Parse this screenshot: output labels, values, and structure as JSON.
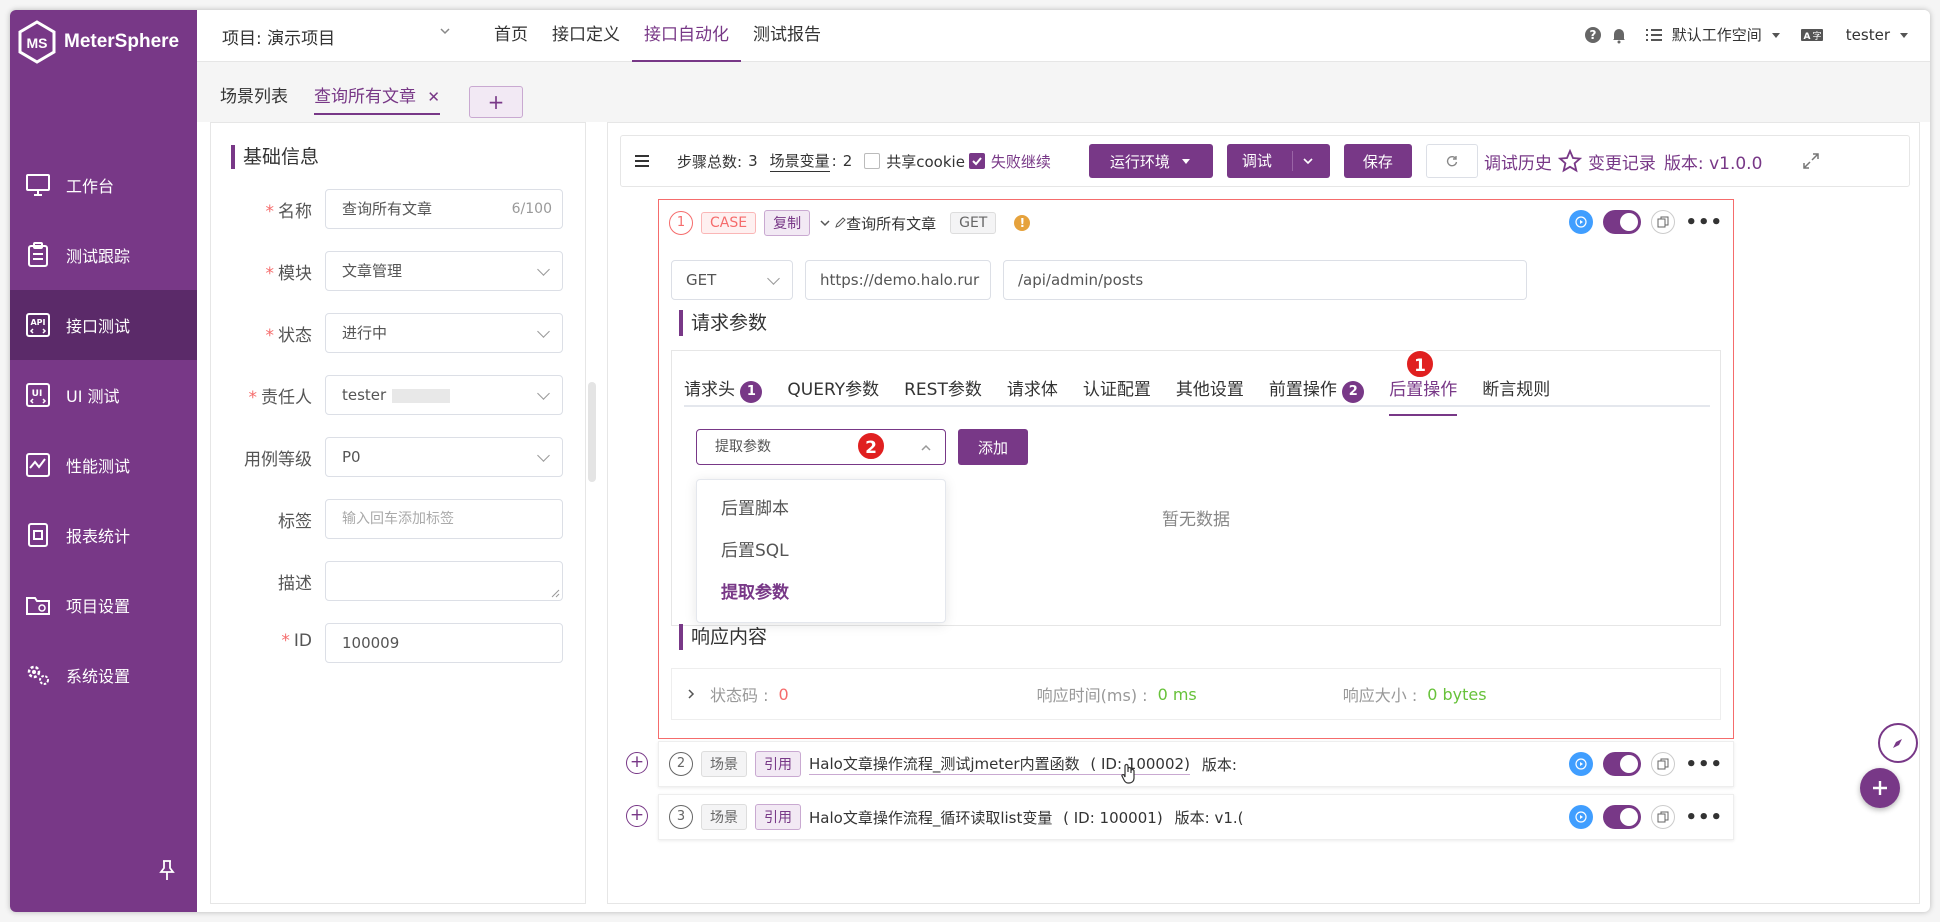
{
  "brand": {
    "name": "MeterSphere"
  },
  "sidebar": {
    "items": [
      {
        "label": "工作台",
        "icon": "monitor-icon"
      },
      {
        "label": "测试跟踪",
        "icon": "clipboard-icon"
      },
      {
        "label": "接口测试",
        "icon": "api-icon",
        "active": true
      },
      {
        "label": "UI 测试",
        "icon": "ui-icon"
      },
      {
        "label": "性能测试",
        "icon": "performance-icon"
      },
      {
        "label": "报表统计",
        "icon": "report-icon"
      },
      {
        "label": "项目设置",
        "icon": "folder-icon"
      },
      {
        "label": "系统设置",
        "icon": "gears-icon"
      }
    ]
  },
  "header": {
    "project": "项目: 演示项目",
    "nav": [
      "首页",
      "接口定义",
      "接口自动化",
      "测试报告"
    ],
    "active_nav": "接口自动化",
    "workspace": "默认工作空间",
    "user": "tester"
  },
  "page_tabs": {
    "list": "场景列表",
    "current": "查询所有文章",
    "add": "+"
  },
  "basic_info": {
    "title": "基础信息",
    "name_label": "名称",
    "name_value": "查询所有文章",
    "name_count": "6/100",
    "module_label": "模块",
    "module_value": "文章管理",
    "status_label": "状态",
    "status_value": "进行中",
    "owner_label": "责任人",
    "owner_value": "tester",
    "level_label": "用例等级",
    "level_value": "P0",
    "tag_label": "标签",
    "tag_placeholder": "输入回车添加标签",
    "desc_label": "描述",
    "id_label": "ID",
    "id_value": "100009"
  },
  "toolbar": {
    "steps_label": "步骤总数:",
    "steps_count": "3",
    "vars_label": "场景变量",
    "vars_sep": ":",
    "vars_count": "2",
    "share_cookie": "共享cookie",
    "fail_continue": "失败继续",
    "env_button": "运行环境",
    "debug_button": "调试",
    "save_button": "保存",
    "debug_history": "调试历史",
    "change_log": "变更记录",
    "version": "版本: v1.0.0"
  },
  "step1": {
    "index": "1",
    "type_tag": "CASE",
    "copy_tag": "复制",
    "name": "查询所有文章",
    "method_tag": "GET",
    "method": "GET",
    "domain": "https://demo.halo.rur",
    "path": "/api/admin/posts",
    "request_title": "请求参数",
    "tabs": [
      "请求头",
      "QUERY参数",
      "REST参数",
      "请求体",
      "认证配置",
      "其他设置",
      "前置操作",
      "后置操作",
      "断言规则"
    ],
    "header_badge": "1",
    "pre_badge": "2",
    "callout_1": "1",
    "callout_2": "2",
    "select_value": "提取参数",
    "add_button": "添加",
    "dropdown": [
      "后置脚本",
      "后置SQL",
      "提取参数"
    ],
    "no_data": "暂无数据",
    "response_title": "响应内容",
    "status_label": "状态码 :",
    "status_value": "0",
    "time_label": "响应时间(ms) :",
    "time_value": "0 ms",
    "size_label": "响应大小 :",
    "size_value": "0 bytes"
  },
  "step2": {
    "index": "2",
    "scene": "场景",
    "ref": "引用",
    "name": "Halo文章操作流程_测试jmeter内置函数",
    "id": "( ID: 100002)",
    "version": "版本:"
  },
  "step3": {
    "index": "3",
    "scene": "场景",
    "ref": "引用",
    "name": "Halo文章操作流程_循环读取list变量",
    "id": "( ID: 100001)",
    "version": "版本: v1.("
  },
  "colors": {
    "brand": "#783887",
    "danger": "#f56c6c",
    "success": "#67c23a",
    "info": "#409eff"
  }
}
